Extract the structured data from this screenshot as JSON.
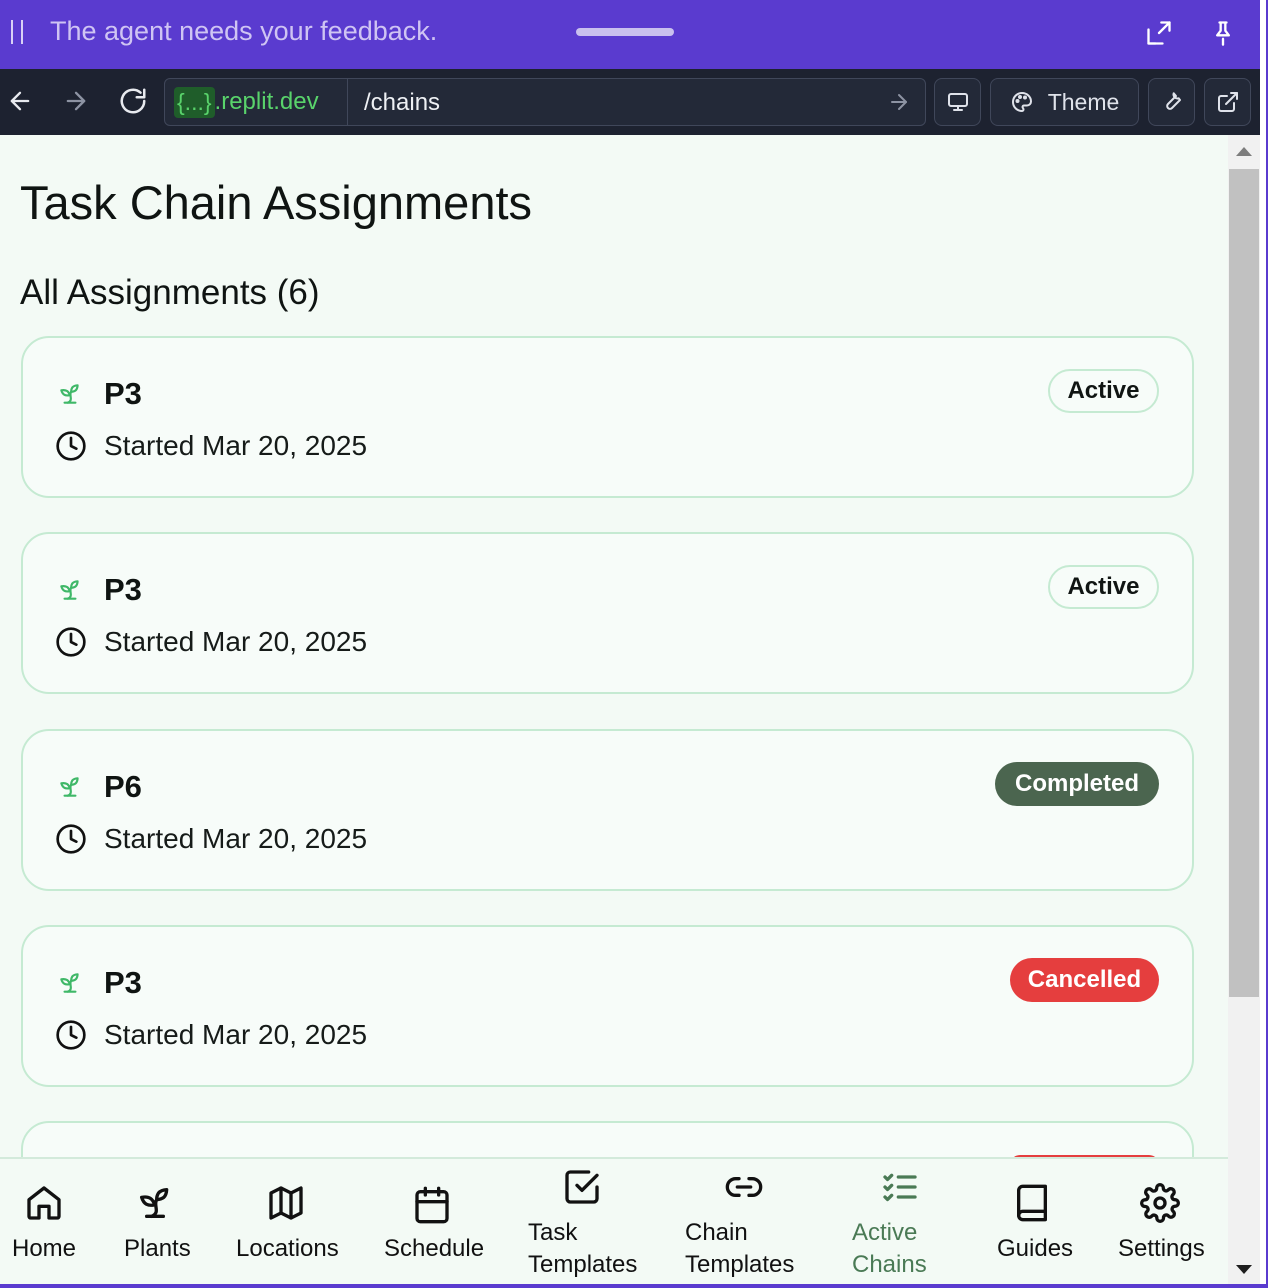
{
  "feedback_bar": {
    "message": "The agent needs your feedback."
  },
  "browser": {
    "url_braces": "{...}",
    "url_host": ".replit.dev",
    "url_path": "/chains",
    "theme_label": "Theme"
  },
  "page": {
    "title": "Task Chain Assignments",
    "section_title": "All Assignments (6)"
  },
  "assignments": [
    {
      "name": "P3",
      "started": "Started Mar 20, 2025",
      "status": "Active"
    },
    {
      "name": "P3",
      "started": "Started Mar 20, 2025",
      "status": "Active"
    },
    {
      "name": "P6",
      "started": "Started Mar 20, 2025",
      "status": "Completed"
    },
    {
      "name": "P3",
      "started": "Started Mar 20, 2025",
      "status": "Cancelled"
    }
  ],
  "nav": {
    "home": "Home",
    "plants": "Plants",
    "locations": "Locations",
    "schedule": "Schedule",
    "task_templates_1": "Task",
    "task_templates_2": "Templates",
    "chain_templates_1": "Chain",
    "chain_templates_2": "Templates",
    "active_chains_1": "Active",
    "active_chains_2": "Chains",
    "guides": "Guides",
    "settings": "Settings",
    "selected": "Active Chains"
  },
  "colors": {
    "feedback_bar": "#5a3bcf",
    "browser_bar": "#1d2230",
    "url_green": "#59d36b",
    "page_bg": "#f3faf5",
    "card_border": "#c5ead2",
    "plant_icon": "#3fb868",
    "completed_badge": "#4b654f",
    "cancelled_badge": "#e53e3e",
    "nav_selected": "#4a7a55"
  }
}
